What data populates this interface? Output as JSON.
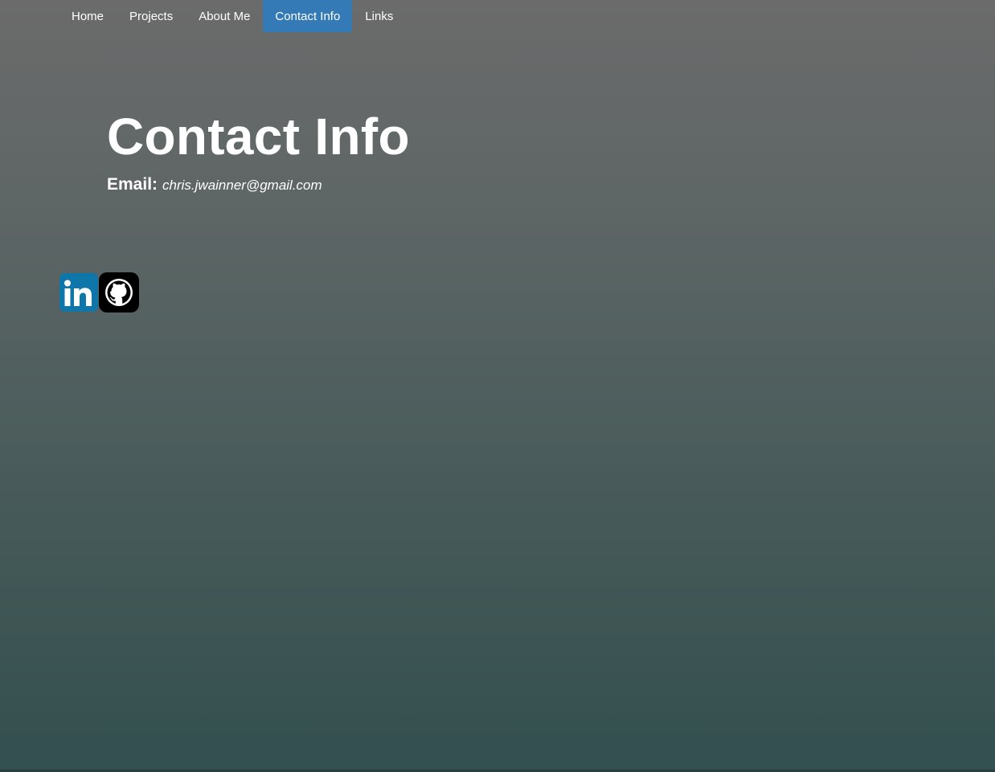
{
  "nav": {
    "items": [
      {
        "label": "Home"
      },
      {
        "label": "Projects"
      },
      {
        "label": "About Me"
      },
      {
        "label": "Contact Info"
      },
      {
        "label": "Links"
      }
    ],
    "active_index": 3
  },
  "main": {
    "title": "Contact Info",
    "email_label": "Email:",
    "email_value": "chris.jwainner@gmail.com"
  },
  "social": {
    "linkedin": {
      "icon": "linkedin-icon",
      "text": "in",
      "color": "#0e76a8"
    },
    "github": {
      "icon": "github-icon",
      "color": "#000000"
    }
  },
  "colors": {
    "accent": "#337ab7",
    "background_top": "#6b6b6b",
    "background_bottom": "#334f4f"
  }
}
